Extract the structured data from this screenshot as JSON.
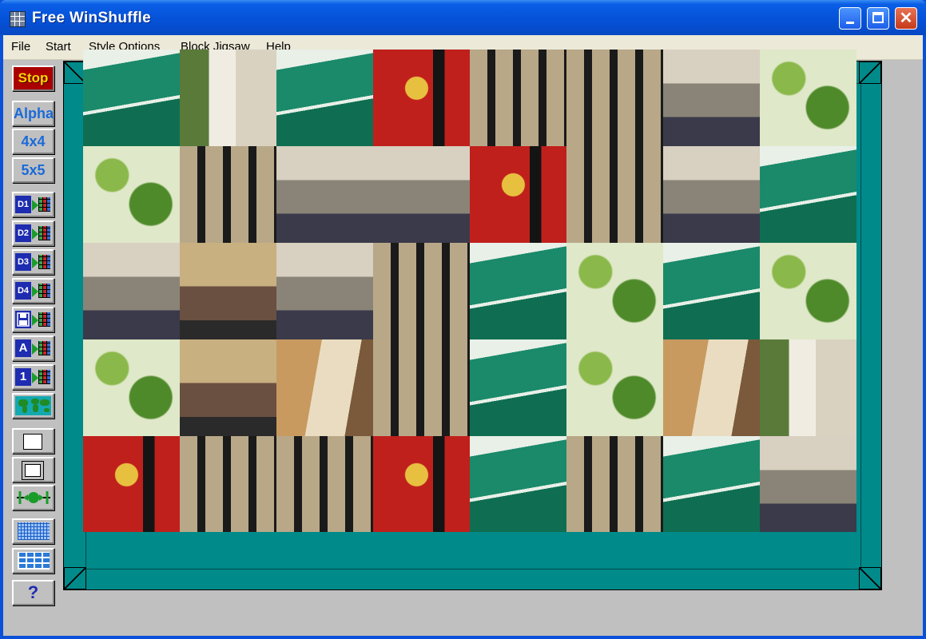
{
  "window": {
    "title": "Free WinShuffle",
    "close_glyph": "✕"
  },
  "menu": [
    "File",
    "Start",
    "Style Options",
    "Block Jigsaw",
    "Help"
  ],
  "toolbar": {
    "stop": "Stop",
    "alpha": "Alpha",
    "size4": "4x4",
    "size5": "5x5",
    "d1": "D1",
    "d2": "D2",
    "d3": "D3",
    "d4": "D4",
    "load_icon": "floppy-disk-icon",
    "a_label": "A",
    "one_label": "1",
    "help": "?"
  },
  "puzzle": {
    "rows": 5,
    "cols": 8,
    "tiles": [
      "canopy",
      "tree",
      "canopy",
      "banner",
      "fence",
      "fence",
      "crowd",
      "leaves",
      "leaves",
      "fence",
      "crowd",
      "crowd",
      "banner",
      "fence",
      "crowd",
      "canopy",
      "crowd",
      "pots",
      "crowd",
      "fence",
      "canopy",
      "leaves",
      "canopy",
      "leaves",
      "leaves",
      "pots",
      "wall",
      "fence",
      "canopy",
      "leaves",
      "wall",
      "tree",
      "banner",
      "fence",
      "fence",
      "banner",
      "canopy",
      "fence",
      "canopy",
      "crowd"
    ],
    "palette": {
      "canopy": [
        "#0f6e52",
        "#1a8a6a",
        "#e8f0e8"
      ],
      "tree": [
        "#d9d2c0",
        "#f0ece2",
        "#5a7a3a"
      ],
      "banner": [
        "#c0201c",
        "#e8c040",
        "#141414"
      ],
      "fence": [
        "#b8a888",
        "#1a1a1a",
        "#8a6a48"
      ],
      "crowd": [
        "#8a8478",
        "#3a3a4a",
        "#d8d0c0"
      ],
      "leaves": [
        "#4e8a2a",
        "#8ab84a",
        "#dfe8c8"
      ],
      "pots": [
        "#6a5040",
        "#c8b080",
        "#2a2a2a"
      ],
      "wall": [
        "#c89a60",
        "#eadcc0",
        "#7a5a3a"
      ]
    }
  }
}
